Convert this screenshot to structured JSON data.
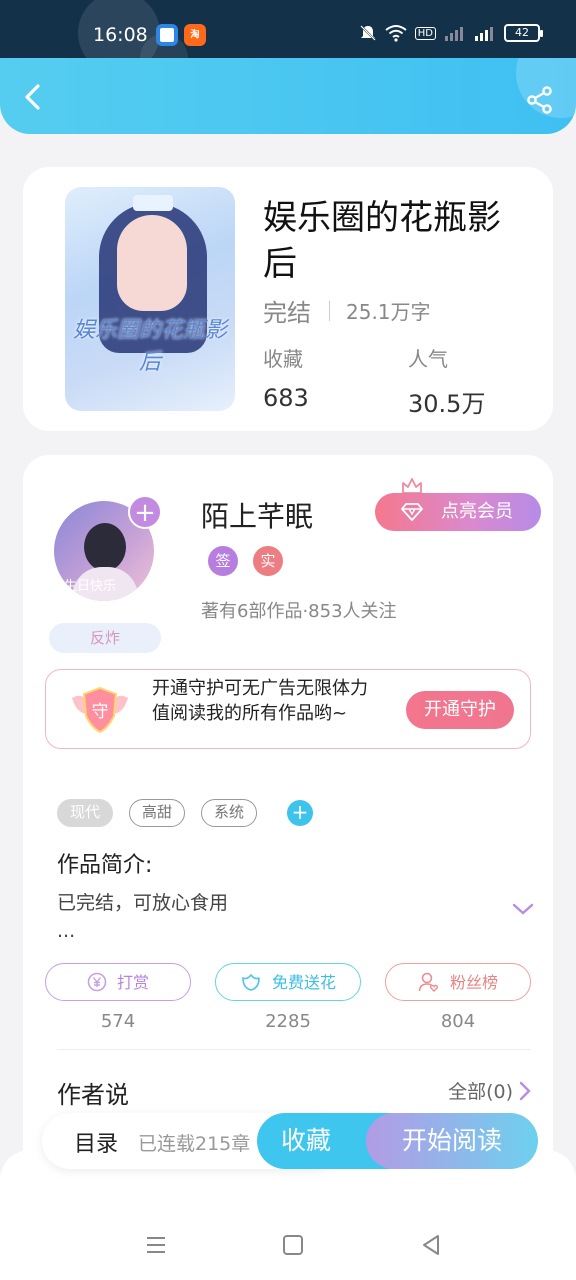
{
  "status_bar": {
    "time": "16:08",
    "app2_label": "淘",
    "hd": "HD",
    "battery": "42"
  },
  "book": {
    "title": "娱乐圈的花瓶影后",
    "cover_art_text": "娱乐圈的花瓶影后",
    "status": "完结",
    "words": "25.1万字",
    "fav_label": "收藏",
    "fav_value": "683",
    "pop_label": "人气",
    "pop_value": "30.5万"
  },
  "author": {
    "name": "陌上芊眠",
    "avatar_text": "生日快乐",
    "badge": "反炸",
    "vip_button": "点亮会员",
    "tag_sign": "签",
    "tag_real": "实",
    "stats": "著有6部作品·853人关注"
  },
  "guard": {
    "text": "开通守护可无广告无限体力值阅读我的所有作品哟~",
    "button": "开通守护",
    "shield_char": "守"
  },
  "tags": [
    "现代",
    "高甜",
    "系统"
  ],
  "intro": {
    "title": "作品简介:",
    "text": "已完结，可放心食用",
    "ellipsis": "..."
  },
  "actions": [
    {
      "label": "打赏",
      "count": "574"
    },
    {
      "label": "免费送花",
      "count": "2285"
    },
    {
      "label": "粉丝榜",
      "count": "804"
    }
  ],
  "author_says": {
    "title": "作者说",
    "all": "全部(0)"
  },
  "bottom": {
    "toc": "目录",
    "serial": "已连载215章",
    "favorite": "收藏",
    "start_read": "开始阅读"
  },
  "colors": {
    "header": "#4ac6f1",
    "accent_purple": "#b786dc",
    "accent_cyan": "#3cbfe0",
    "accent_red": "#e88484",
    "guard_button": "#f3758e"
  }
}
